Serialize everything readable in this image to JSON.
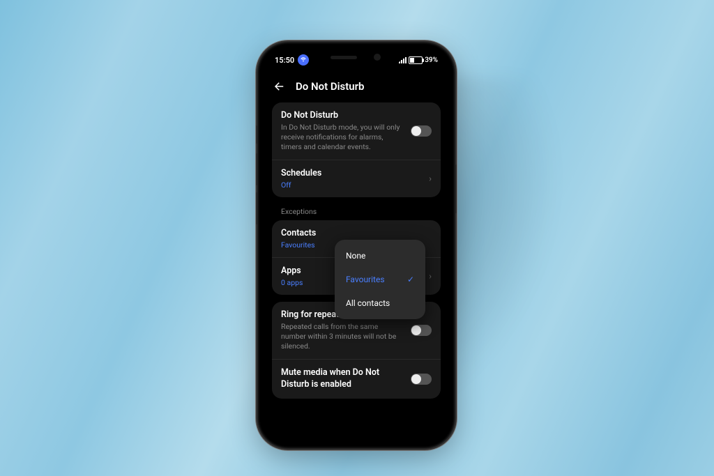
{
  "status": {
    "time": "15:50",
    "battery_text": "39%"
  },
  "appbar": {
    "title": "Do Not Disturb"
  },
  "card1": {
    "dnd": {
      "title": "Do Not Disturb",
      "desc": "In Do Not Disturb mode, you will only receive notifications for alarms, timers and calendar events."
    },
    "schedules": {
      "title": "Schedules",
      "value": "Off"
    }
  },
  "exceptions_label": "Exceptions",
  "card2": {
    "contacts": {
      "title": "Contacts",
      "value": "Favourites"
    },
    "apps": {
      "title": "Apps",
      "value": "0 apps"
    }
  },
  "card3": {
    "repeat": {
      "title": "Ring for repeated calls",
      "desc": "Repeated calls from the same number within 3 minutes will not be silenced."
    },
    "mute": {
      "title": "Mute media when Do Not Disturb is enabled"
    }
  },
  "popup": {
    "options": [
      "None",
      "Favourites",
      "All contacts"
    ],
    "selected": "Favourites"
  }
}
